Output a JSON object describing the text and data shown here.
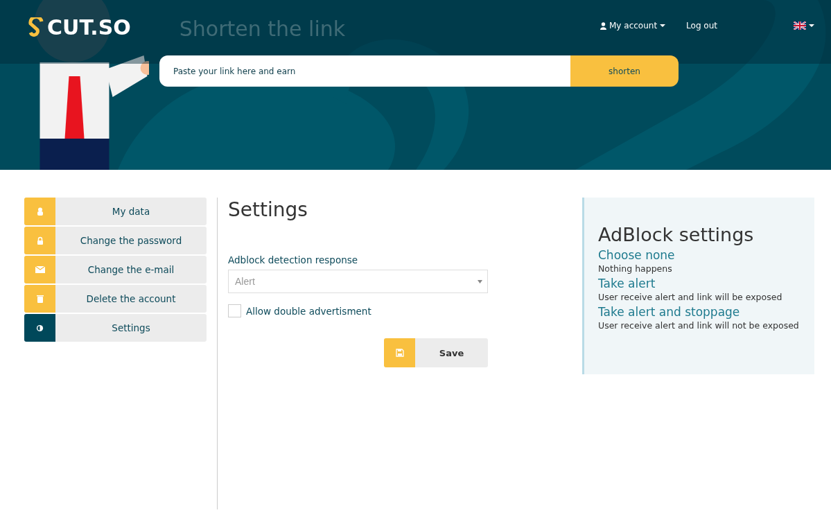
{
  "header": {
    "logo": "CUT.SO",
    "title": "Shorten the link",
    "nav": [
      {
        "kind": "account",
        "label": "My account"
      },
      {
        "kind": "link",
        "label": "Log out"
      },
      {
        "kind": "language"
      }
    ]
  },
  "shortener": {
    "placeholder": "Paste your link here and earn",
    "button": "shorten"
  },
  "sidebar": {
    "items": [
      {
        "kind": "data",
        "label": "My data",
        "selected": false
      },
      {
        "kind": "password",
        "label": "Change the password",
        "selected": false
      },
      {
        "kind": "email",
        "label": "Change the e-mail",
        "selected": false
      },
      {
        "kind": "delete",
        "label": "Delete the account",
        "selected": false
      },
      {
        "kind": "settings",
        "label": "Settings",
        "selected": true
      }
    ]
  },
  "settings": {
    "title": "Settings",
    "select_label": "Adblock detection response",
    "select_value": "Alert",
    "checkbox": {
      "label": "Allow double advertisment",
      "checked": false
    },
    "save": "Save"
  },
  "adblock_panel": {
    "title": "AdBlock settings",
    "options": [
      {
        "name": "Choose none",
        "description": "Nothing happens"
      },
      {
        "name": "Take alert",
        "description": "User receive alert and link will be exposed"
      },
      {
        "name": "Take alert and stoppage",
        "description": "User receive alert and link will not be exposed"
      }
    ]
  }
}
